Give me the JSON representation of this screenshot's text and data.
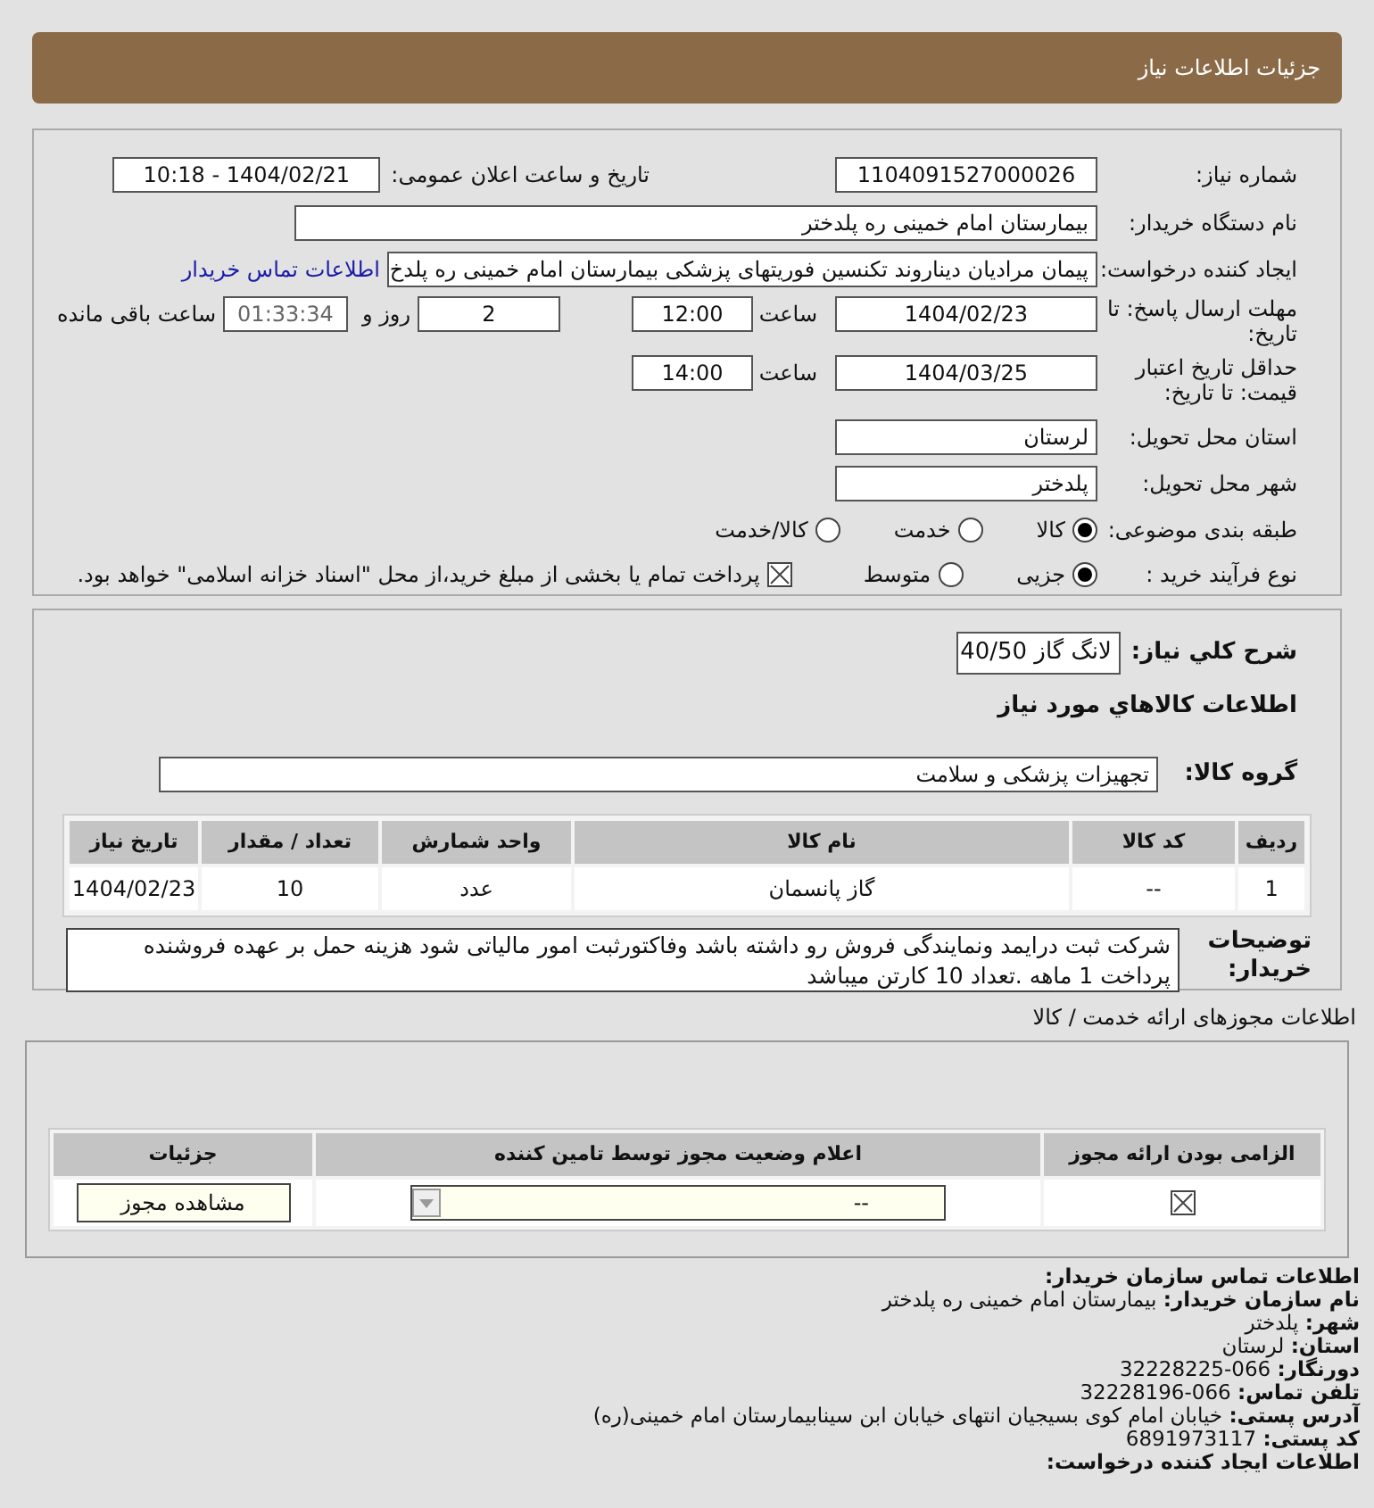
{
  "header": {
    "title": "جزئیات اطلاعات نیاز"
  },
  "need_info": {
    "need_number": {
      "label": "شماره نیاز:",
      "value": "1104091527000026"
    },
    "announce_datetime": {
      "label": "تاریخ و ساعت اعلان عمومی:",
      "value": "1404/02/21 - 10:18"
    },
    "buyer_org": {
      "label": "نام دستگاه خریدار:",
      "value": "بیمارستان امام خمینی ره پلدختر"
    },
    "requester": {
      "label": "ایجاد کننده درخواست:",
      "value": "پیمان مرادیان دیناروند تکنسین فوریتهای پزشکی بیمارستان امام خمینی ره پلدخ",
      "link": "اطلاعات تماس خریدار"
    },
    "reply_deadline": {
      "label": "مهلت ارسال پاسخ: تا تاریخ:",
      "date": "1404/02/23",
      "time_label": "ساعت",
      "time": "12:00",
      "days": "2",
      "days_label": "روز و",
      "remaining": "01:33:34",
      "remaining_label": "ساعت باقی مانده"
    },
    "price_validity": {
      "label": "حداقل تاریخ اعتبار قیمت: تا تاریخ:",
      "date": "1404/03/25",
      "time_label": "ساعت",
      "time": "14:00"
    },
    "province": {
      "label": "استان محل تحویل:",
      "value": "لرستان"
    },
    "city": {
      "label": "شهر محل تحویل:",
      "value": "پلدختر"
    },
    "category": {
      "label": "طبقه بندی موضوعی:",
      "options": [
        {
          "label": "کالا",
          "selected": true
        },
        {
          "label": "خدمت",
          "selected": false
        },
        {
          "label": "کالا/خدمت",
          "selected": false
        }
      ]
    },
    "purchase_type": {
      "label": "نوع فرآیند خرید :",
      "options": [
        {
          "label": "جزیی",
          "selected": true
        },
        {
          "label": "متوسط",
          "selected": false
        }
      ],
      "treasury": {
        "checked": true,
        "label": "پرداخت تمام یا بخشی از مبلغ خرید،از محل \"اسناد خزانه اسلامی\" خواهد بود."
      }
    }
  },
  "goods": {
    "description": {
      "label": "شرح کلي نياز:",
      "value": "لانگ گاز 40/50"
    },
    "heading": "اطلاعات كالاهاي مورد نياز",
    "group": {
      "label": "گروه کالا:",
      "value": "تجهیزات پزشکی و سلامت"
    },
    "table": {
      "columns": [
        "ردیف",
        "کد کالا",
        "نام کالا",
        "واحد شمارش",
        "تعداد / مقدار",
        "تاریخ نیاز"
      ],
      "rows": [
        [
          "1",
          "--",
          "گاز پانسمان",
          "عدد",
          "10",
          "1404/02/23"
        ]
      ]
    },
    "buyer_notes": {
      "label": "توضیحات خریدار:",
      "value": "شرکت ثبت درایمد ونمایندگی فروش رو داشته باشد وفاکتورثبت امور مالیاتی شود هزینه حمل بر عهده فروشنده پرداخت 1 ماهه .تعداد 10 کارتن میباشد"
    }
  },
  "licenses": {
    "heading": "اطلاعات مجوزهای ارائه خدمت / کالا",
    "columns": [
      "الزامی بودن ارائه مجوز",
      "اعلام وضعیت مجوز توسط تامین کننده",
      "جزئیات"
    ],
    "rows": [
      {
        "required": true,
        "status": "--",
        "button": "مشاهده مجوز"
      }
    ]
  },
  "contact": {
    "heading": "اطلاعات تماس سازمان خریدار:",
    "items": [
      {
        "label": "نام سازمان خریدار:",
        "value": "بیمارستان امام خمینی ره پلدختر"
      },
      {
        "label": "شهر:",
        "value": "پلدختر"
      },
      {
        "label": "استان:",
        "value": "لرستان"
      },
      {
        "label": "دورنگار:",
        "value": "066-32228225"
      },
      {
        "label": "تلفن تماس:",
        "value": "066-32228196"
      },
      {
        "label": "آدرس پستی:",
        "value": "خیابان امام کوی بسیجیان انتهای خیابان ابن سینابیمارستان امام خمینی(ره)"
      },
      {
        "label": "کد پستی:",
        "value": "6891973117"
      }
    ],
    "next_heading": "اطلاعات ایجاد کننده درخواست:"
  }
}
